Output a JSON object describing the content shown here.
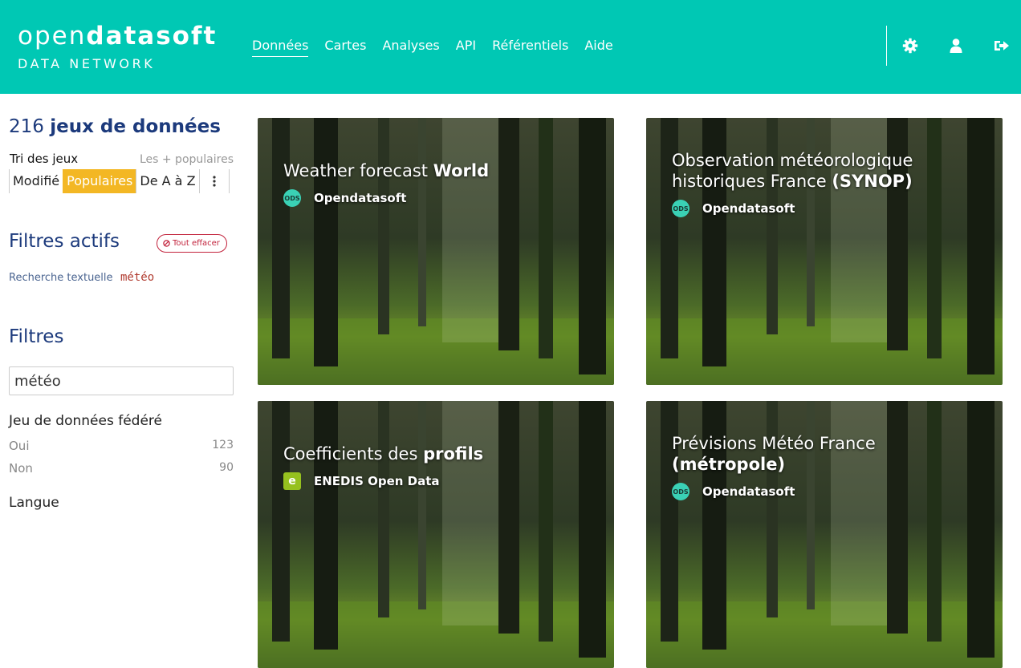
{
  "brand": {
    "name_light": "open",
    "name_bold": "datasoft",
    "subtitle": "DATA NETWORK"
  },
  "nav": [
    {
      "label": "Données",
      "active": true
    },
    {
      "label": "Cartes",
      "active": false
    },
    {
      "label": "Analyses",
      "active": false
    },
    {
      "label": "API",
      "active": false
    },
    {
      "label": "Référentiels",
      "active": false
    },
    {
      "label": "Aide",
      "active": false
    }
  ],
  "header_icons": [
    "gear-icon",
    "user-icon",
    "sign-out-icon"
  ],
  "colors": {
    "accent": "#00c8b4",
    "title_blue": "#1c3a7c",
    "sort_active": "#f3b724",
    "danger": "#c2233c"
  },
  "sidebar": {
    "count_number": "216",
    "count_label": "jeux de données",
    "sort": {
      "label": "Tri des jeux",
      "current": "Les + populaires",
      "options": [
        "Modifié",
        "Populaires",
        "De A à Z"
      ],
      "active_index": 1
    },
    "active_filters": {
      "title": "Filtres actifs",
      "clear_label": "Tout effacer",
      "key": "Recherche textuelle",
      "value": "météo"
    },
    "filters": {
      "title": "Filtres",
      "search_value": "météo",
      "facet": {
        "title": "Jeu de données fédéré",
        "items": [
          {
            "label": "Oui",
            "count": "123"
          },
          {
            "label": "Non",
            "count": "90"
          }
        ]
      },
      "next_facet_title": "Langue"
    }
  },
  "cards": [
    {
      "title_plain": "Weather forecast ",
      "title_bold": "World",
      "publisher": "Opendatasoft",
      "logo": "ods"
    },
    {
      "title_plain": "Observation météorologique historiques France ",
      "title_bold": "(SYNOP)",
      "publisher": "Opendatasoft",
      "logo": "ods"
    },
    {
      "title_plain": "Coefficients des ",
      "title_bold": "profils",
      "publisher": "ENEDIS Open Data",
      "logo": "enedis"
    },
    {
      "title_plain": "Prévisions Météo France ",
      "title_bold": "(métropole)",
      "publisher": "Opendatasoft",
      "logo": "ods"
    }
  ]
}
